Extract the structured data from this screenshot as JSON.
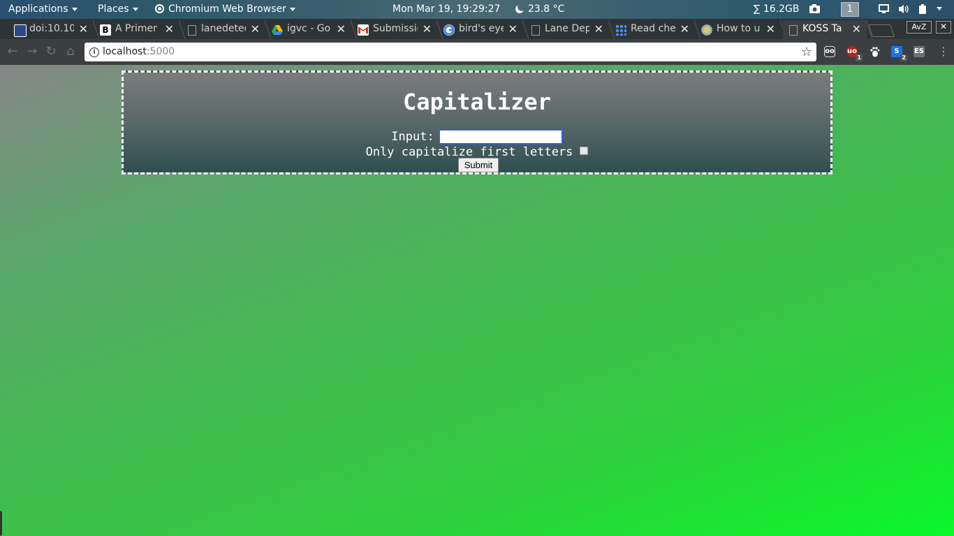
{
  "panel": {
    "applications": "Applications",
    "places": "Places",
    "active_app": "Chromium Web Browser",
    "clock": "Mon Mar 19, 19:29:27",
    "weather": "23.8 °C",
    "memory": "∑ 16.2GB",
    "workspace": "1"
  },
  "tabs": [
    {
      "title": "doi:10.10",
      "icon": "doi-icon",
      "color": "#2c4a8a"
    },
    {
      "title": "A Primer",
      "icon": "blogger-b-icon",
      "color": "#ffffff"
    },
    {
      "title": "lanedetec",
      "icon": "page-icon",
      "color": "#000000"
    },
    {
      "title": "igvc - Go",
      "icon": "google-drive-icon",
      "color": "#34a853"
    },
    {
      "title": "Submissic",
      "icon": "gmail-icon",
      "color": "#d93025"
    },
    {
      "title": "bird's eye",
      "icon": "google-icon",
      "color": "#4285f4"
    },
    {
      "title": "Lane Dep",
      "icon": "page-icon",
      "color": "#000000"
    },
    {
      "title": "Read che",
      "icon": "dots-icon",
      "color": "#4a8cff"
    },
    {
      "title": "How to u",
      "icon": "globe-icon",
      "color": "#6aa0d8"
    },
    {
      "title": "KOSS Ta",
      "icon": "page-icon",
      "color": "#000000",
      "active": true
    }
  ],
  "window_buttons": {
    "avz": "AvZ",
    "close": "✕"
  },
  "toolbar": {
    "url_host": "localhost",
    "url_port": ":5000",
    "extensions": [
      {
        "name": "tampermonkey-icon",
        "label": "oo"
      },
      {
        "name": "ublock-icon",
        "label": "uo",
        "badge": "1"
      },
      {
        "name": "gnome-foot-icon",
        "label": ""
      },
      {
        "name": "s-extension-icon",
        "label": "S",
        "badge": "2"
      },
      {
        "name": "es-extension-icon",
        "label": "ES"
      }
    ]
  },
  "page": {
    "title": "Capitalizer",
    "input_label": "Input:",
    "input_value": "",
    "checkbox_label": "Only capitalize first letters",
    "checkbox_checked": false,
    "submit_label": "Submit"
  }
}
